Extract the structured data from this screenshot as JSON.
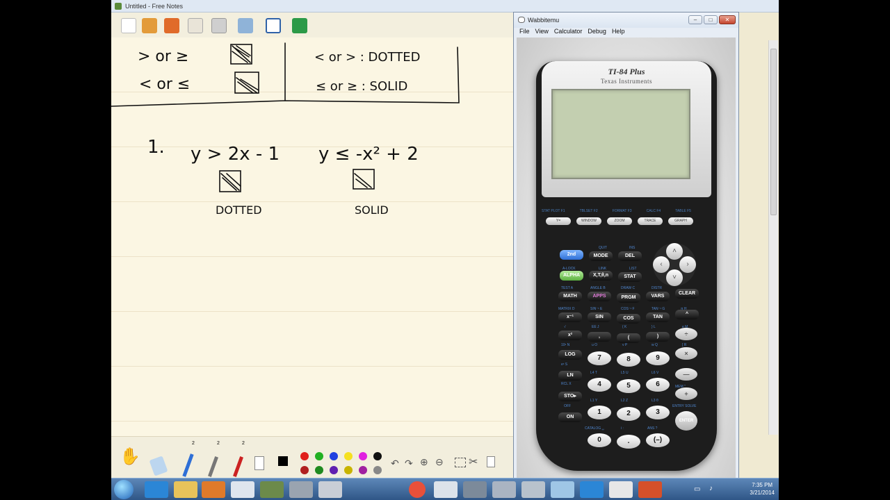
{
  "notes": {
    "window_title": "Untitled - Free Notes",
    "handwriting": {
      "box_left_row1": "> or ≥",
      "box_left_row2": "< or ≤",
      "box_right_row1": "< or > : DOTTED",
      "box_right_row2": "≤ or ≥ : SOLID",
      "problem_number": "1.",
      "inequality_a": "y > 2x - 1",
      "inequality_b": "y ≤ -x² + 2",
      "label_a": "DOTTED",
      "label_b": "SOLID"
    },
    "pen_sizes": [
      "2",
      "2",
      "2"
    ],
    "palette_colors": [
      "#000000",
      "#e0201b",
      "#22b022",
      "#2040e0",
      "#f5e020",
      "#e020e0",
      "#111111",
      "#b02020",
      "#208a20",
      "#6020b0",
      "#c8b400",
      "#a020a0",
      "#888888"
    ]
  },
  "emulator": {
    "window_title": "Wabbitemu",
    "window_buttons": [
      "–",
      "□",
      "✕"
    ],
    "menu": [
      "File",
      "View",
      "Calculator",
      "Debug",
      "Help"
    ],
    "calculator": {
      "model": "TI-84 Plus",
      "brand": "Texas Instruments",
      "fkey_labels": [
        "STAT PLOT F1",
        "TBLSET F2",
        "FORMAT F3",
        "CALC F4",
        "TABLE F5"
      ],
      "fkeys": [
        "Y=",
        "WINDOW",
        "ZOOM",
        "TRACE",
        "GRAPH"
      ],
      "keys": {
        "second": "2nd",
        "mode": "MODE",
        "del": "DEL",
        "alpha": "ALPHA",
        "xt": "X,T,θ,n",
        "stat": "STAT",
        "math": "MATH",
        "apps": "APPS",
        "prgm": "PRGM",
        "vars": "VARS",
        "clear": "CLEAR",
        "inv": "x⁻¹",
        "sin": "SIN",
        "cos": "COS",
        "tan": "TAN",
        "caret": "^",
        "sq": "x²",
        "comma": ",",
        "lparen": "(",
        "rparen": ")",
        "div": "÷",
        "log": "LOG",
        "seven": "7",
        "eight": "8",
        "nine": "9",
        "mul": "×",
        "ln": "LN",
        "four": "4",
        "five": "5",
        "six": "6",
        "minus": "—",
        "sto": "STO▸",
        "one": "1",
        "two": "2",
        "three": "3",
        "plus": "+",
        "on": "ON",
        "zero": "0",
        "dot": ".",
        "neg": "(–)",
        "enter": "ENTER"
      },
      "second_labels": {
        "quit": "QUIT",
        "ins": "INS",
        "alock": "A-LOCK",
        "link": "LINK",
        "list": "LIST",
        "test": "TEST A",
        "angle": "ANGLE B",
        "draw": "DRAW C",
        "distr": "DISTR",
        "matrix": "MATRIX D",
        "sin_inv": "SIN⁻¹ E",
        "cos_inv": "COS⁻¹ F",
        "tan_inv": "TAN⁻¹ G",
        "pi": "π H",
        "sqrt": "√",
        "ee": "EE J",
        "brace_l": "{ K",
        "brace_r": "} L",
        "e": "e M",
        "tenx": "10ˣ N",
        "u": "u O",
        "v": "v P",
        "w": "w Q",
        "brack": "[ R",
        "ex": "eˣ S",
        "l4": "L4 T",
        "l5": "L5 U",
        "l6": "L6 V",
        "brack2": "] W",
        "rcl": "RCL X",
        "l1": "L1 Y",
        "l2": "L2 Z",
        "l3": "L3 θ",
        "mem": "MEM \"",
        "off": "OFF",
        "catalog": "CATALOG ␣",
        "i": "i :",
        "ans": "ANS ?",
        "entry": "ENTRY SOLVE"
      }
    }
  },
  "taskbar": {
    "time": "7:35 PM",
    "date": "3/21/2014"
  }
}
